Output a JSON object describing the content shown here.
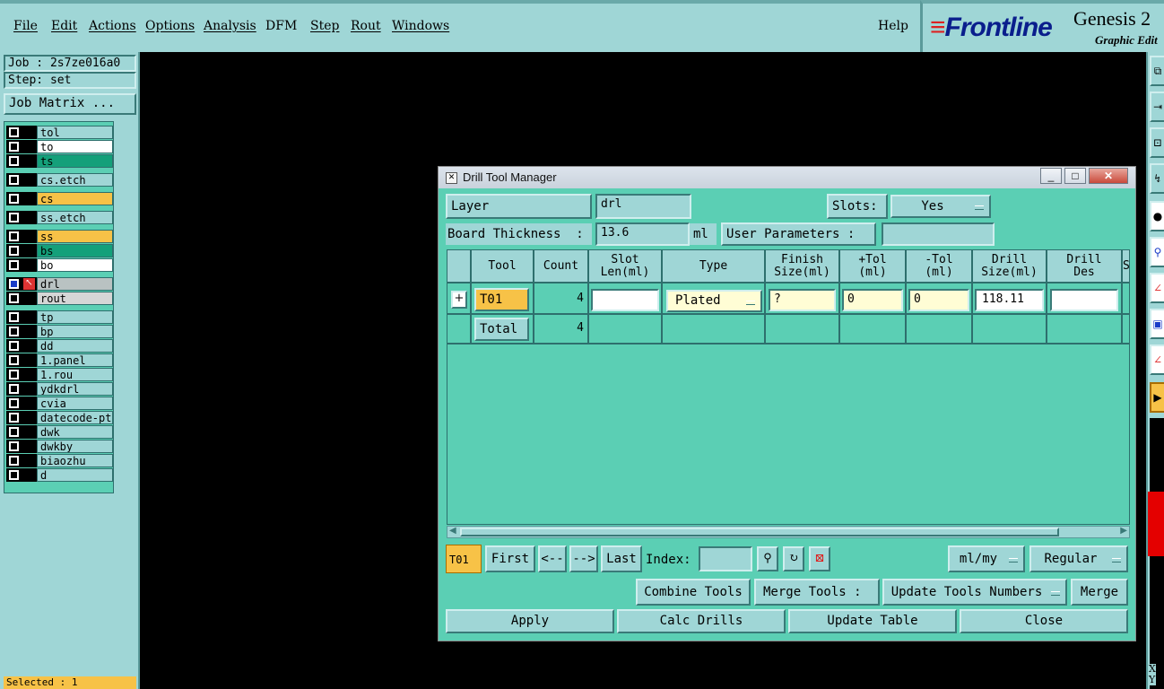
{
  "menu": {
    "items": [
      "File",
      "Edit",
      "Actions",
      "Options",
      "Analysis",
      "DFM",
      "Step",
      "Rout",
      "Windows"
    ],
    "help": "Help"
  },
  "logo": {
    "brand": "Frontline",
    "product": "Genesis 2",
    "subtitle": "Graphic Edit"
  },
  "job": {
    "job": "Job : 2s7ze016a0",
    "step": "Step: set",
    "matrix_button": "Job Matrix ..."
  },
  "layers": [
    {
      "name": "tol",
      "color": "#9fd6d6"
    },
    {
      "name": "to",
      "color": "#ffffff"
    },
    {
      "name": "ts",
      "color": "#14a07a"
    },
    {
      "name": "cs.etch",
      "color": "#9fd6d6"
    },
    {
      "name": "cs",
      "color": "#f7c247"
    },
    {
      "name": "ss.etch",
      "color": "#9fd6d6"
    },
    {
      "name": "ss",
      "color": "#f7c247"
    },
    {
      "name": "bs",
      "color": "#14a07a"
    },
    {
      "name": "bo",
      "color": "#ffffff"
    },
    {
      "name": "drl",
      "color": "#b9c2c2"
    },
    {
      "name": "rout",
      "color": "#d6d6d6"
    },
    {
      "name": "tp",
      "color": "#9fd6d6"
    },
    {
      "name": "bp",
      "color": "#9fd6d6"
    },
    {
      "name": "dd",
      "color": "#9fd6d6"
    },
    {
      "name": "1.panel",
      "color": "#9fd6d6"
    },
    {
      "name": "1.rou",
      "color": "#9fd6d6"
    },
    {
      "name": "ydkdrl",
      "color": "#9fd6d6"
    },
    {
      "name": "cvia",
      "color": "#9fd6d6"
    },
    {
      "name": "datecode-pt",
      "color": "#9fd6d6"
    },
    {
      "name": "dwk",
      "color": "#9fd6d6"
    },
    {
      "name": "dwkby",
      "color": "#9fd6d6"
    },
    {
      "name": "biaozhu",
      "color": "#9fd6d6"
    },
    {
      "name": "d",
      "color": "#9fd6d6"
    }
  ],
  "selected": "Selected : 1",
  "status_xy": [
    "X",
    "Y"
  ],
  "dialog": {
    "title": "Drill Tool Manager",
    "layer_label": "Layer                :",
    "layer_value": "drl",
    "slots_label": "Slots:",
    "slots_value": "Yes",
    "thickness_label": "Board Thickness  :",
    "thickness_value": "13.6",
    "thickness_unit": "ml",
    "user_params_label": "User Parameters :",
    "user_params_value": "",
    "columns": [
      "",
      "Tool",
      "Count",
      "Slot\nLen(ml)",
      "Type",
      "Finish\nSize(ml)",
      "+Tol\n(ml)",
      "-Tol\n(ml)",
      "Drill\nSize(ml)",
      "Drill\nDes",
      "S"
    ],
    "row": {
      "tool": "T01",
      "count": "4",
      "slot_len": "",
      "type": "Plated",
      "finish": "?",
      "ptol": "0",
      "mtol": "0",
      "drill_size": "118.11",
      "drill_des": ""
    },
    "total": {
      "label": "Total",
      "count": "4"
    },
    "nav": {
      "current_tool": "T01",
      "first": "First",
      "prev": "<--",
      "next": "-->",
      "last": "Last",
      "index_label": "Index:",
      "index_value": "",
      "units": "ml/my",
      "mode": "Regular"
    },
    "actions": {
      "combine": "Combine Tools",
      "merge_label": "Merge Tools :",
      "merge_option": "Update Tools Numbers",
      "merge": "Merge",
      "apply": "Apply",
      "calc": "Calc Drills",
      "update": "Update Table",
      "close": "Close"
    }
  }
}
